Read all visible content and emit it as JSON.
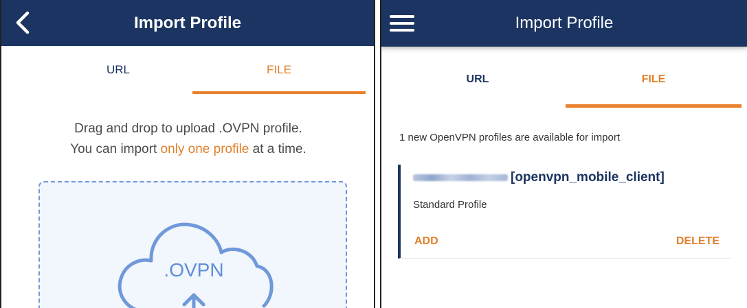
{
  "left_screen": {
    "header": {
      "title": "Import Profile",
      "back_icon": "chevron-left-icon"
    },
    "tabs": [
      {
        "label": "URL",
        "active": false
      },
      {
        "label": "FILE",
        "active": true
      }
    ],
    "instructions": {
      "line1": "Drag and drop to upload .OVPN profile.",
      "line2_prefix": "You can import ",
      "line2_highlight": "only one profile",
      "line2_suffix": " at a time."
    },
    "dropzone": {
      "icon": "cloud-upload-icon",
      "label": ".OVPN"
    }
  },
  "right_screen": {
    "header": {
      "title": "Import Profile",
      "menu_icon": "hamburger-menu-icon"
    },
    "tabs": [
      {
        "label": "URL",
        "active": false
      },
      {
        "label": "FILE",
        "active": true
      }
    ],
    "available_text": "1 new OpenVPN profiles are available for import",
    "profile_card": {
      "name_suffix": "[openvpn_mobile_client]",
      "subtitle": "Standard Profile",
      "add_label": "ADD",
      "delete_label": "DELETE"
    }
  },
  "colors": {
    "header_bg": "#1b3461",
    "accent_orange": "#e0802b",
    "dropzone_blue": "#6f99d9"
  }
}
